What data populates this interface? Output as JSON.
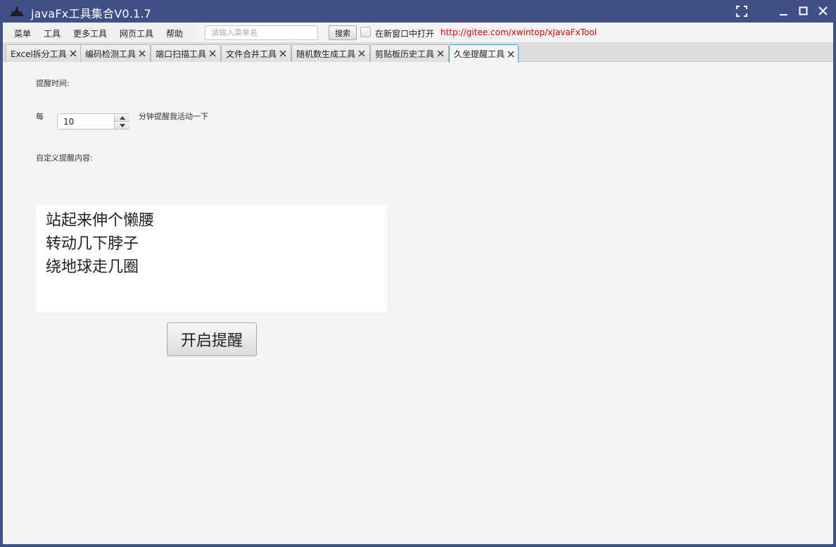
{
  "window": {
    "title": "javaFx工具集合V0.1.7"
  },
  "menubar": {
    "items": [
      "菜单",
      "工具",
      "更多工具",
      "网页工具",
      "帮助"
    ],
    "search_placeholder": "请输入菜单名",
    "search_button": "搜索",
    "open_new_window_label": "在新窗口中打开",
    "repo_link": "http://gitee.com/xwintop/xJavaFxTool"
  },
  "tabs": [
    {
      "label": "Excel拆分工具"
    },
    {
      "label": "编码检测工具"
    },
    {
      "label": "端口扫描工具"
    },
    {
      "label": "文件合并工具"
    },
    {
      "label": "随机数生成工具"
    },
    {
      "label": "剪贴板历史工具"
    },
    {
      "label": "久坐提醒工具",
      "active": true
    }
  ],
  "reminder": {
    "time_label": "提醒时间:",
    "every_label": "每",
    "interval_value": "10",
    "interval_suffix": "分钟提醒我活动一下",
    "custom_content_label": "自定义提醒内容:",
    "content_lines": [
      "站起来伸个懒腰",
      "转动几下脖子",
      "绕地球走几圈"
    ],
    "start_button": "开启提醒"
  },
  "colors": {
    "titlebar": "#3f5089",
    "link": "#e00000",
    "active_tab_border": "#3aa0d8"
  }
}
